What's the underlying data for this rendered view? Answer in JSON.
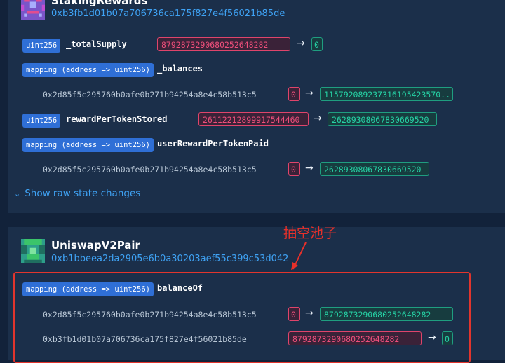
{
  "contract1": {
    "name": "StakingRewards",
    "address": "0xb3fb1d01b07a706736ca175f827e4f56021b85de",
    "icon": "pixel-identicon-purple",
    "vars": [
      {
        "type": "uint256",
        "name": "_totalSupply",
        "old": "879287329068025264828​2",
        "new": "0"
      },
      {
        "type": "mapping (address => uint256)",
        "name": "_balances"
      },
      {
        "key": "0x2d85f5c295760b0afe0b271b94254a8e4c58b513c5",
        "old": "0",
        "new": "115792089237316195423570..."
      },
      {
        "type": "uint256",
        "name": "rewardPerTokenStored",
        "old": "26112212899917544460",
        "new": "26289308067830669520"
      },
      {
        "type": "mapping (address => uint256)",
        "name": "userRewardPerTokenPaid"
      },
      {
        "key": "0x2d85f5c295760b0afe0b271b94254a8e4c58b513c5",
        "old": "0",
        "new": "26289308067830669520"
      }
    ],
    "raw_toggle": "Show raw state changes"
  },
  "contract2": {
    "name": "UniswapV2Pair",
    "address": "0xb1bbeea2da2905e6b0a30203aef55c399c53d042",
    "icon": "pixel-identicon-green",
    "vars": [
      {
        "type": "mapping (address => uint256)",
        "name": "balanceOf"
      },
      {
        "key": "0x2d85f5c295760b0afe0b271b94254a8e4c58b513c5",
        "old": "0",
        "new": "879287329068025264828​2"
      },
      {
        "key": "0xb3fb1d01b07a706736ca175f827e4f56021b85de",
        "old": "879287329068025264828​2",
        "new": "0"
      }
    ]
  },
  "annotation": {
    "text": "抽空池子",
    "color": "#e8302a"
  },
  "colors": {
    "old_value": "#ef4f7b",
    "new_value": "#26d3a6",
    "tag_bg": "#2f6fd6",
    "link": "#3fa3f5"
  }
}
